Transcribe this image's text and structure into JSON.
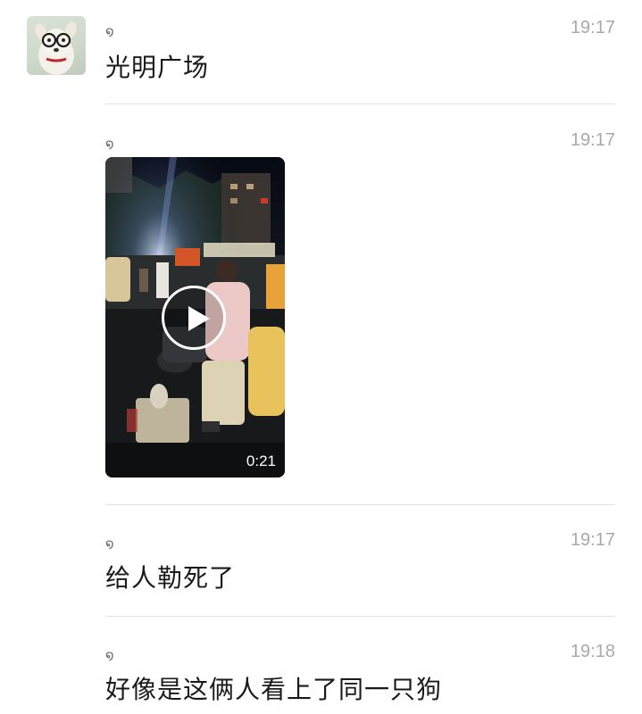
{
  "messages": [
    {
      "sender": "໑",
      "time": "19:17",
      "text": "光明广场"
    },
    {
      "sender": "໑",
      "time": "19:17",
      "video": {
        "duration": "0:21"
      }
    },
    {
      "sender": "໑",
      "time": "19:17",
      "text": "给人勒死了"
    },
    {
      "sender": "໑",
      "time": "19:18",
      "text": "好像是这俩人看上了同一只狗"
    }
  ],
  "icons": {
    "avatar": "dog-with-glasses-avatar",
    "play": "play-icon"
  },
  "colors": {
    "background": "#ffffff",
    "text": "#1a1a1a",
    "timestamp": "#a9a9a9",
    "divider": "#e3e3e3"
  }
}
